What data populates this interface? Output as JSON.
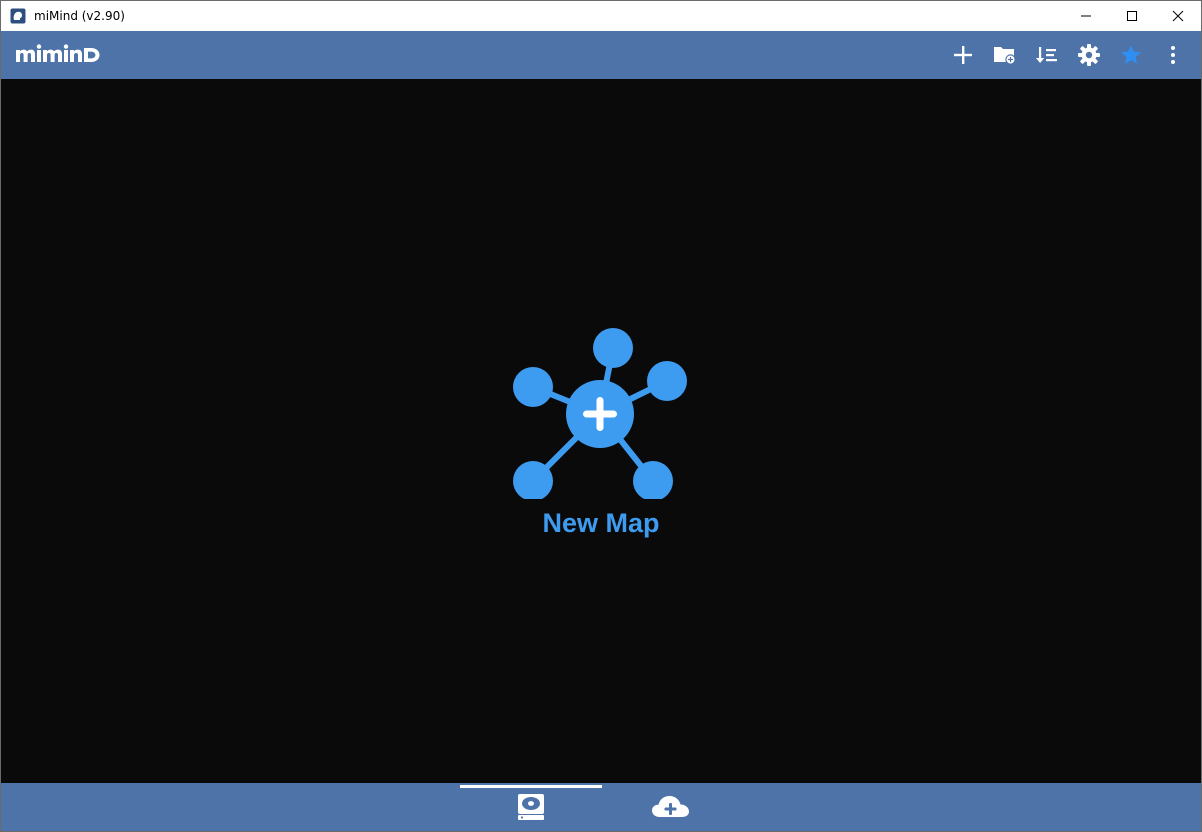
{
  "window": {
    "title": "miMind (v2.90)"
  },
  "appbar": {
    "logo_text": "miMinD",
    "icons": [
      "plus-icon",
      "folder-add-icon",
      "sort-icon",
      "gear-icon",
      "star-icon",
      "more-vertical-icon"
    ]
  },
  "main": {
    "new_map_label": "New Map"
  },
  "bottom_tabs": [
    {
      "icon": "local-storage-icon",
      "selected": true
    },
    {
      "icon": "cloud-add-icon",
      "selected": false
    }
  ],
  "colors": {
    "appbar": "#4e73a8",
    "accent": "#3e9cf0",
    "background": "#0a0a0a",
    "star": "#2f8ef0"
  }
}
